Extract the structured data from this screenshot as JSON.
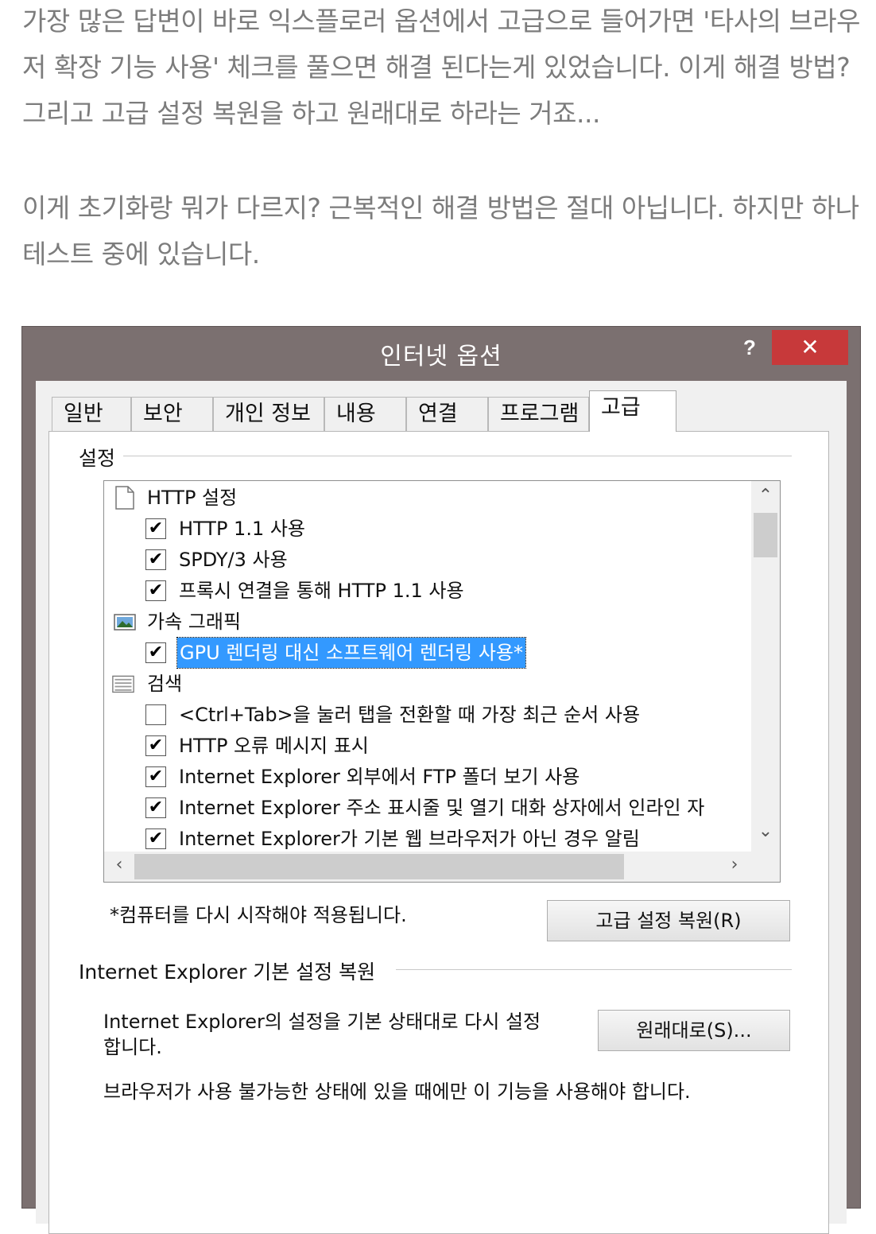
{
  "article": {
    "para1": "가장 많은 답변이 바로 익스플로러 옵션에서 고급으로 들어가면 '타사의 브라우저 확장 기능 사용' 체크를 풀으면 해결 된다는게 있었습니다. 이게 해결 방법? 그리고 고급 설정 복원을 하고 원래대로 하라는 거죠...",
    "para2": "이게 초기화랑 뭐가 다르지? 근복적인 해결 방법은 절대 아닙니다. 하지만 하나 테스트 중에 있습니다."
  },
  "dialog": {
    "title": "인터넷 옵션",
    "help": "?",
    "close": "✕",
    "tabs": [
      "일반",
      "보안",
      "개인 정보",
      "내용",
      "연결",
      "프로그램",
      "고급"
    ],
    "settings_group": "설정",
    "settings_list": [
      {
        "type": "category",
        "icon": "page-icon",
        "label": "HTTP 설정"
      },
      {
        "type": "check",
        "checked": true,
        "label": "HTTP 1.1 사용"
      },
      {
        "type": "check",
        "checked": true,
        "label": "SPDY/3 사용"
      },
      {
        "type": "check",
        "checked": true,
        "label": "프록시 연결을 통해 HTTP 1.1 사용"
      },
      {
        "type": "category",
        "icon": "image-icon",
        "label": "가속 그래픽"
      },
      {
        "type": "check",
        "checked": true,
        "label": "GPU 렌더링 대신 소프트웨어 렌더링 사용*",
        "selected": true
      },
      {
        "type": "category",
        "icon": "list-icon",
        "label": "검색"
      },
      {
        "type": "check",
        "checked": false,
        "label": "<Ctrl+Tab>을 눌러 탭을 전환할 때 가장 최근 순서 사용"
      },
      {
        "type": "check",
        "checked": true,
        "label": "HTTP 오류 메시지 표시"
      },
      {
        "type": "check",
        "checked": true,
        "label": "Internet Explorer 외부에서 FTP 폴더 보기 사용"
      },
      {
        "type": "check",
        "checked": true,
        "label": "Internet Explorer 주소 표시줄 및 열기 대화 상자에서 인라인 자"
      },
      {
        "type": "check",
        "checked": true,
        "label": "Internet Explorer가 기본 웹 브라우저가 아닌 경우 알림"
      }
    ],
    "restart_note": "*컴퓨터를 다시 시작해야 적용됩니다.",
    "restore_advanced_button": "고급 설정 복원(R)",
    "reset_group": "Internet Explorer 기본 설정 복원",
    "reset_desc_line1": "Internet Explorer의 설정을 기본 상태대로 다시 설정",
    "reset_desc_line2": "합니다.",
    "reset_button": "원래대로(S)...",
    "reset_warning": "브라우저가 사용 불가능한 상태에 있을 때에만 이 기능을 사용해야 합니다."
  }
}
